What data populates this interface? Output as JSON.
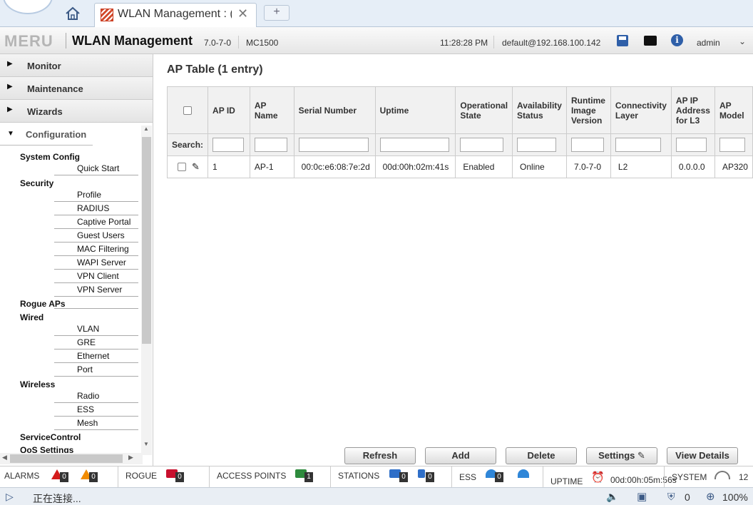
{
  "browser": {
    "tab_title": "WLAN Management : (",
    "close_glyph": "✕",
    "new_tab_glyph": "+"
  },
  "header": {
    "logo": "MERU",
    "title": "WLAN Management",
    "version": "7.0-7-0",
    "model": "MC1500",
    "time": "11:28:28 PM",
    "user_host": "default@192.168.100.142",
    "user": "admin"
  },
  "sidebar": {
    "sections": [
      {
        "label": "Monitor"
      },
      {
        "label": "Maintenance"
      },
      {
        "label": "Wizards"
      }
    ],
    "open_section": "Configuration",
    "groups": [
      {
        "label": "System Config",
        "items": [
          "Quick Start"
        ]
      },
      {
        "label": "Security",
        "items": [
          "Profile",
          "RADIUS",
          "Captive Portal",
          "Guest Users",
          "MAC Filtering",
          "WAPI Server",
          "VPN Client",
          "VPN Server"
        ]
      },
      {
        "label": "Rogue APs",
        "items": []
      },
      {
        "label": "Wired",
        "items": [
          "VLAN",
          "GRE",
          "Ethernet",
          "Port"
        ]
      },
      {
        "label": "Wireless",
        "items": [
          "Radio",
          "ESS",
          "Mesh"
        ]
      },
      {
        "label": "ServiceControl",
        "items": []
      },
      {
        "label": "QoS Settings",
        "items": []
      }
    ]
  },
  "main": {
    "title": "AP Table (1 entry)",
    "search_label": "Search:",
    "columns": [
      "AP ID",
      "AP Name",
      "Serial Number",
      "Uptime",
      "Operational State",
      "Availability Status",
      "Runtime Image Version",
      "Connectivity Layer",
      "AP IP Address for L3",
      "AP Model"
    ],
    "rows": [
      [
        "1",
        "AP-1",
        "00:0c:e6:08:7e:2d",
        "00d:00h:02m:41s",
        "Enabled",
        "Online",
        "7.0-7-0",
        "L2",
        "0.0.0.0",
        "AP320"
      ]
    ],
    "buttons": {
      "refresh": "Refresh",
      "add": "Add",
      "delete": "Delete",
      "settings": "Settings",
      "view_details": "View Details"
    }
  },
  "statusbar": {
    "alarms_label": "ALARMS",
    "alarms_critical": "0",
    "alarms_major": "0",
    "rogue_label": "ROGUE",
    "rogue_count": "0",
    "ap_label": "ACCESS POINTS",
    "ap_count": "1",
    "stations_label": "STATIONS",
    "stations_a": "0",
    "stations_b": "0",
    "ess_label": "ESS",
    "ess_count": "0",
    "uptime_label": "UPTIME",
    "uptime_value": "00d:00h:05m:56s",
    "system_label": "SYSTEM",
    "system_value": "12"
  },
  "browser_status": {
    "text": "正在连接...",
    "shield_count": "0",
    "zoom": "100%"
  },
  "colors": {
    "brand_red": "#d24a2b",
    "alert_red": "#d41c1c",
    "alert_orange": "#f28c00",
    "icon_blue": "#2f5fa8"
  }
}
